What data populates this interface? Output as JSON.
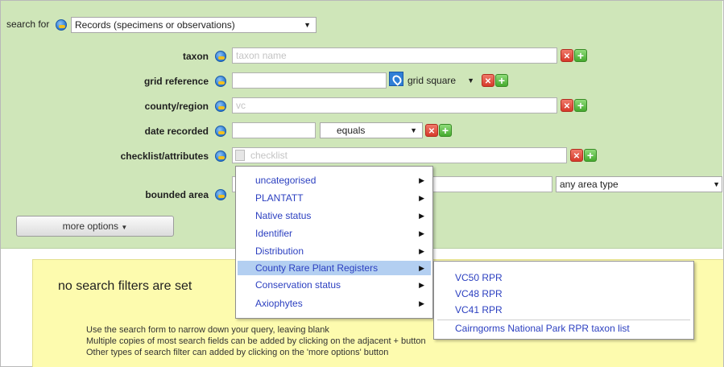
{
  "search": {
    "label": "search for",
    "type_value": "Records (specimens or observations)"
  },
  "fields": {
    "taxon": {
      "label": "taxon",
      "placeholder": "taxon name"
    },
    "grid_reference": {
      "label": "grid reference",
      "placeholder": "",
      "square_select": "grid square"
    },
    "county_region": {
      "label": "county/region",
      "placeholder": "vc"
    },
    "date_recorded": {
      "label": "date recorded",
      "value": "",
      "operator": "equals"
    },
    "checklist_attributes": {
      "label": "checklist/attributes",
      "placeholder": "checklist"
    },
    "bounded_area": {
      "label": "bounded area",
      "area_type": "any area type"
    }
  },
  "more_options_label": "more options",
  "checklist_menu": {
    "items": [
      "uncategorised",
      "PLANTATT",
      "Native status",
      "Identifier",
      "Distribution",
      "County Rare Plant Registers",
      "Conservation status",
      "Axiophytes"
    ],
    "active": "County Rare Plant Registers"
  },
  "rpr_submenu": {
    "items": [
      "VC50 RPR",
      "VC48 RPR",
      "VC41 RPR",
      "Cairngorms National Park RPR taxon list"
    ]
  },
  "info": {
    "title": "no search filters are set",
    "lines": [
      "Use the search form to narrow down your query, leaving blank",
      "Multiple copies of most search fields can be added by clicking on the adjacent + button",
      "Other types of search filter can added by clicking on the 'more options' button"
    ]
  },
  "icons": {
    "help": "help-icon",
    "delete": "delete-icon",
    "add": "add-icon",
    "grid_lookup": "map-pin-icon"
  },
  "colors": {
    "form_panel_bg": "#cfe6b9",
    "info_bg": "#fdfbae",
    "link_blue": "#2b3fc0",
    "menu_highlight": "#b3cff1"
  }
}
